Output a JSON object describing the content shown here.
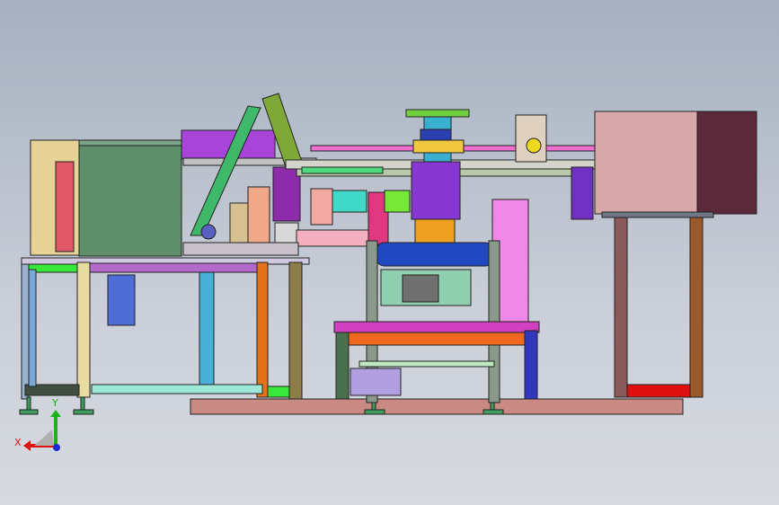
{
  "viewport": {
    "axis_x_label": "X",
    "axis_y_label": "Y",
    "axis_x_color": "#e01010",
    "axis_y_color": "#18b418",
    "axis_z_color": "#1a2ad0",
    "background_top": "#a5b0bf",
    "background_bottom": "#d7dae0"
  }
}
